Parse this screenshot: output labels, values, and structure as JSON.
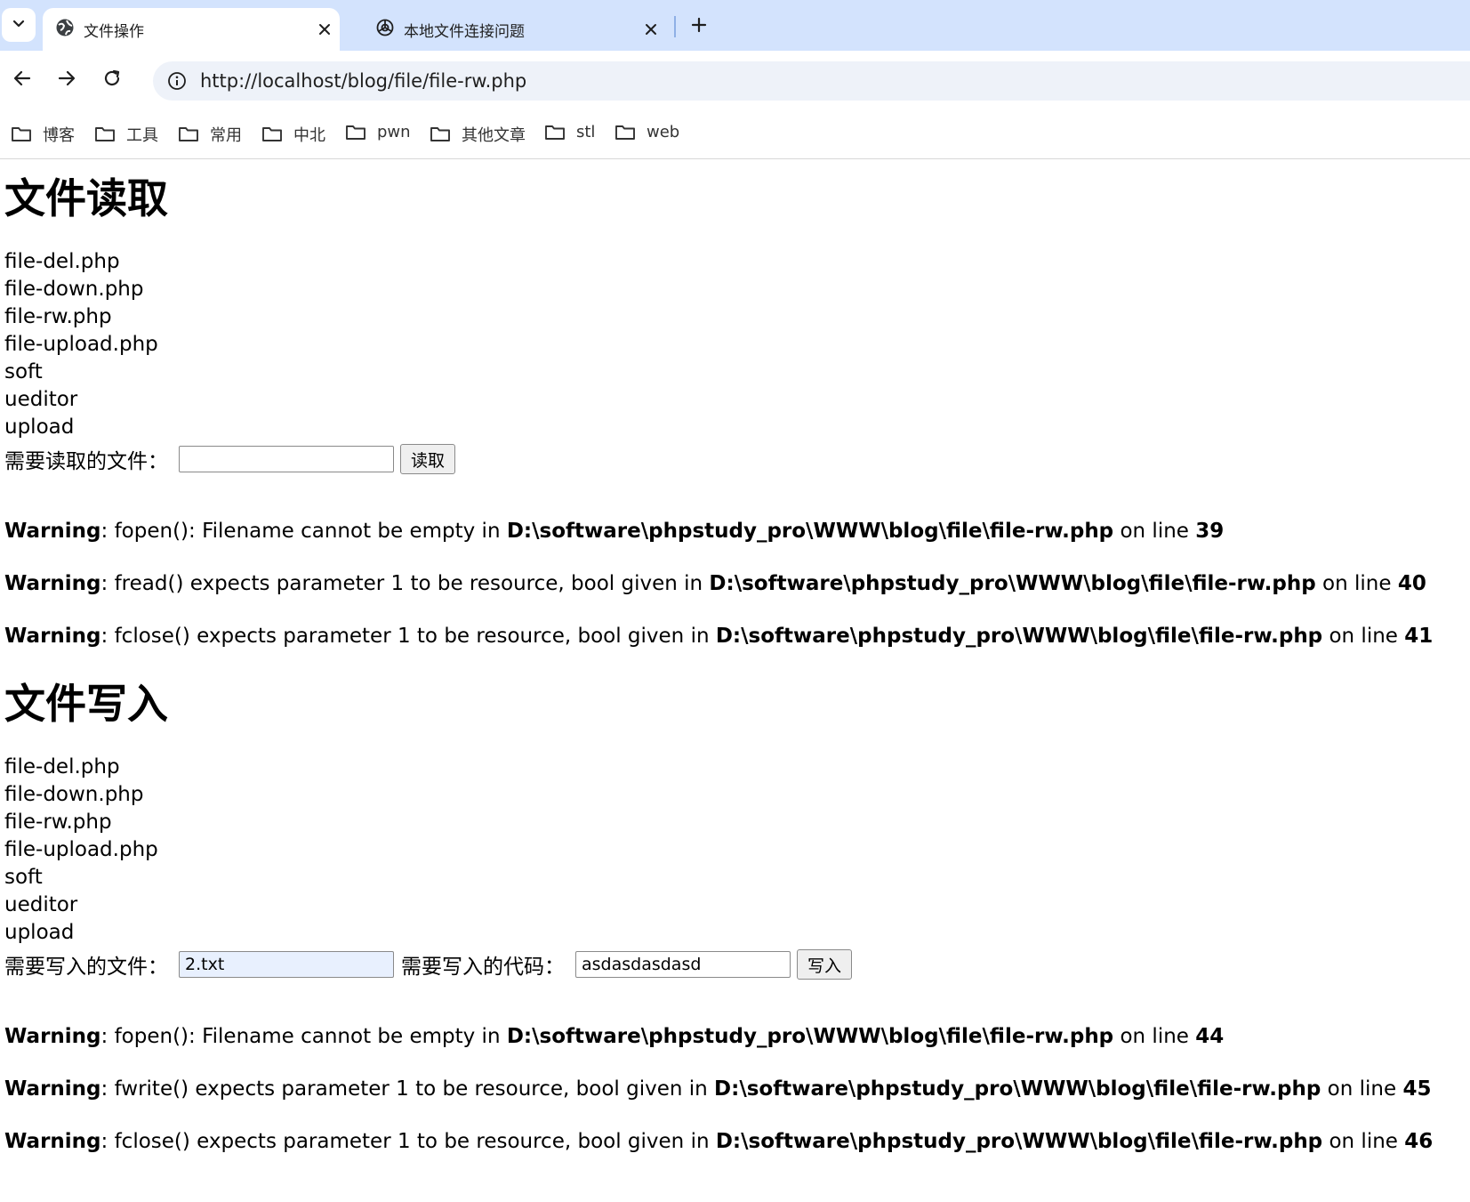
{
  "browser": {
    "tabs": [
      {
        "title": "文件操作",
        "active": true
      },
      {
        "title": "本地文件连接问题",
        "active": false
      }
    ],
    "url": "http://localhost/blog/file/file-rw.php",
    "bookmarks": [
      "博客",
      "工具",
      "常用",
      "中北",
      "pwn",
      "其他文章",
      "stl",
      "web"
    ],
    "icons": [
      "chevron-down-icon",
      "globe-icon",
      "close-icon",
      "openai-icon",
      "plus-icon",
      "back-icon",
      "forward-icon",
      "reload-icon",
      "info-icon",
      "folder-icon"
    ]
  },
  "read_section": {
    "heading": "文件读取",
    "files": [
      "file-del.php",
      "file-down.php",
      "file-rw.php",
      "file-upload.php",
      "soft",
      "ueditor",
      "upload"
    ],
    "label": "需要读取的文件：",
    "input_value": "",
    "button": "读取",
    "warnings": [
      {
        "tag": "Warning",
        "msg": ": fopen(): Filename cannot be empty in ",
        "path": "D:\\software\\phpstudy_pro\\WWW\\blog\\file\\file-rw.php",
        "online": " on line ",
        "line": "39"
      },
      {
        "tag": "Warning",
        "msg": ": fread() expects parameter 1 to be resource, bool given in ",
        "path": "D:\\software\\phpstudy_pro\\WWW\\blog\\file\\file-rw.php",
        "online": " on line ",
        "line": "40"
      },
      {
        "tag": "Warning",
        "msg": ": fclose() expects parameter 1 to be resource, bool given in ",
        "path": "D:\\software\\phpstudy_pro\\WWW\\blog\\file\\file-rw.php",
        "online": " on line ",
        "line": "41"
      }
    ]
  },
  "write_section": {
    "heading": "文件写入",
    "files": [
      "file-del.php",
      "file-down.php",
      "file-rw.php",
      "file-upload.php",
      "soft",
      "ueditor",
      "upload"
    ],
    "file_label": "需要写入的文件：",
    "file_value": "2.txt",
    "code_label": "需要写入的代码：",
    "code_value": "asdasdasdasd",
    "button": "写入",
    "warnings": [
      {
        "tag": "Warning",
        "msg": ": fopen(): Filename cannot be empty in ",
        "path": "D:\\software\\phpstudy_pro\\WWW\\blog\\file\\file-rw.php",
        "online": " on line ",
        "line": "44"
      },
      {
        "tag": "Warning",
        "msg": ": fwrite() expects parameter 1 to be resource, bool given in ",
        "path": "D:\\software\\phpstudy_pro\\WWW\\blog\\file\\file-rw.php",
        "online": " on line ",
        "line": "45"
      },
      {
        "tag": "Warning",
        "msg": ": fclose() expects parameter 1 to be resource, bool given in ",
        "path": "D:\\software\\phpstudy_pro\\WWW\\blog\\file\\file-rw.php",
        "online": " on line ",
        "line": "46"
      }
    ]
  }
}
